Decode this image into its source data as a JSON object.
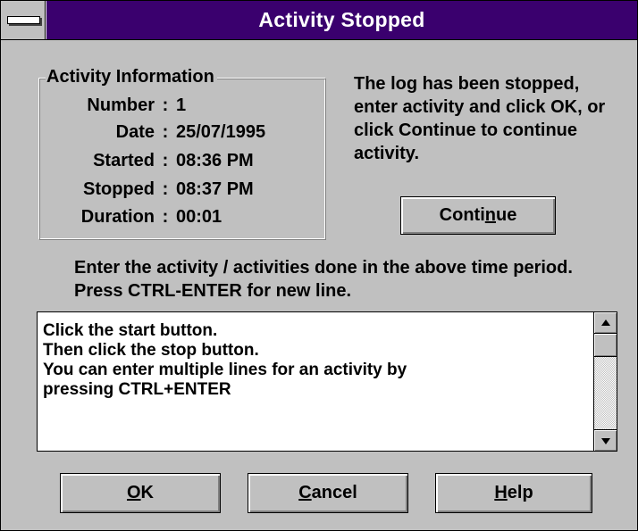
{
  "window": {
    "title": "Activity Stopped"
  },
  "info_group": {
    "title": "Activity Information",
    "rows": [
      {
        "label": "Number",
        "value": "1"
      },
      {
        "label": "Date",
        "value": "25/07/1995"
      },
      {
        "label": "Started",
        "value": "08:36 PM"
      },
      {
        "label": "Stopped",
        "value": "08:37 PM"
      },
      {
        "label": "Duration",
        "value": "00:01"
      }
    ]
  },
  "message": "The log has been stopped, enter activity and click OK, or click Continue to continue activity.",
  "continue_button": {
    "pre": "Conti",
    "accel": "n",
    "post": "ue"
  },
  "prompt": "Enter the activity / activities done in the above time period. Press CTRL-ENTER for new line.",
  "activity_text": [
    "Click the start button.",
    "Then click the stop button.",
    "You can enter multiple lines for an activity by",
    "pressing CTRL+ENTER"
  ],
  "scrollbar": {
    "up_icon": "arrow-up-icon",
    "down_icon": "arrow-down-icon"
  },
  "buttons": {
    "ok": {
      "accel": "O",
      "post": "K"
    },
    "cancel": {
      "accel": "C",
      "post": "ancel"
    },
    "help": {
      "accel": "H",
      "post": "elp"
    }
  },
  "colors": {
    "title_bar": "#3a006e",
    "face": "#c0c0c0"
  }
}
